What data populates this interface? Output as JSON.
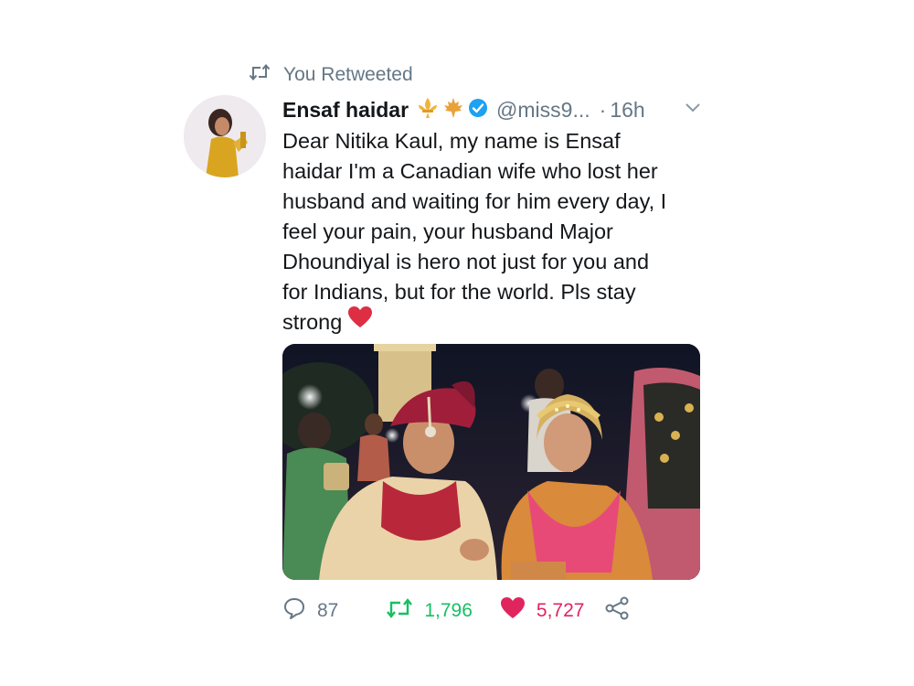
{
  "retweet_context": {
    "label": "You Retweeted",
    "icon": "retweet-icon"
  },
  "tweet": {
    "author_name": "Ensaf haidar",
    "name_badges": [
      "fleur-de-lis-emoji",
      "maple-leaf-emoji",
      "verified-badge-icon"
    ],
    "handle": "@miss9...",
    "separator": "·",
    "time": "16h",
    "text_lines": [
      "Dear Nitika Kaul, my name is Ensaf",
      "haidar I'm a Canadian wife who lost her",
      "husband and waiting for him every day, I",
      "feel your pain, your husband Major",
      "Dhoundiyal is hero not just for you and",
      "for Indians, but for the world. Pls stay",
      "strong"
    ],
    "media": {
      "type": "photo",
      "icon": "wedding-photo"
    }
  },
  "actions": {
    "replies": "87",
    "retweets": "1,796",
    "likes": "5,727"
  },
  "colors": {
    "retweet": "#17bf63",
    "like": "#e0245e",
    "secondary": "#657786",
    "verified": "#1da1f2"
  }
}
